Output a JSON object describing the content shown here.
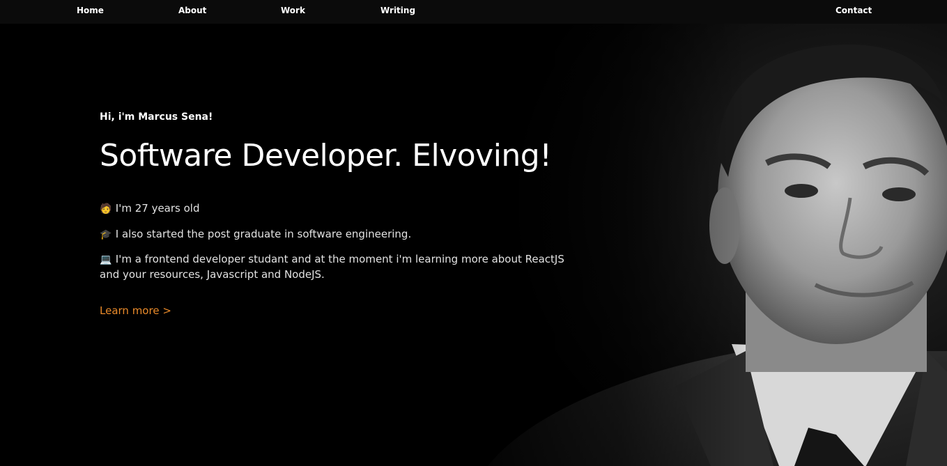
{
  "nav": {
    "home": "Home",
    "about": "About",
    "work": "Work",
    "writing": "Writing",
    "contact": "Contact"
  },
  "hero": {
    "greeting": "Hi, i'm Marcus Sena!",
    "headline": "Software Developer. Elvoving!",
    "facts": [
      {
        "icon": "person-icon",
        "emoji": "🧑",
        "text": "I'm 27 years old"
      },
      {
        "icon": "graduation-cap-icon",
        "emoji": "🎓",
        "text": "I also started the post graduate in software engineering."
      },
      {
        "icon": "laptop-icon",
        "emoji": "💻",
        "text": "I'm a frontend developer studant and at the moment i'm learning more about ReactJS and your resources, Javascript and NodeJS."
      }
    ],
    "learn_more": "Learn more >"
  },
  "colors": {
    "background": "#000000",
    "nav_background": "#0b0b0b",
    "accent": "#e98a2a",
    "text": "#ffffff",
    "body_text": "#e2e2e2"
  }
}
